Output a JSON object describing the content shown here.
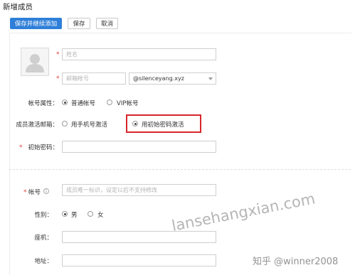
{
  "page": {
    "title": "新增成员"
  },
  "toolbar": {
    "save_continue": "保存并继续添加",
    "save": "保存",
    "cancel": "取消"
  },
  "form": {
    "name_placeholder": "姓名",
    "email_placeholder": "邮箱帐号",
    "email_domain": "@silenceyang.xyz",
    "account_type": {
      "label": "帐号属性：",
      "options": [
        "普通帐号",
        "VIP帐号"
      ],
      "selected": "普通帐号"
    },
    "activation": {
      "label": "成员激活邮箱：",
      "options": [
        "用手机号激活",
        "用初始密码激活"
      ],
      "selected": "用初始密码激活"
    },
    "initial_password_label": "初始密码：",
    "account_id": {
      "label": "帐号",
      "help_icon_text": "i",
      "placeholder": "成员唯一标识，设定以后不支持修改"
    },
    "gender": {
      "label": "性别：",
      "options": [
        "男",
        "女"
      ],
      "selected": "男"
    },
    "phone_label": "座机：",
    "address_label": "地址："
  },
  "required_mark": "*",
  "watermarks": {
    "site": "lansehangxian.com",
    "author": "知乎 @winner2008"
  },
  "colors": {
    "primary": "#2e7fd9",
    "required": "#e23b3b",
    "highlight": "#d6262a"
  }
}
